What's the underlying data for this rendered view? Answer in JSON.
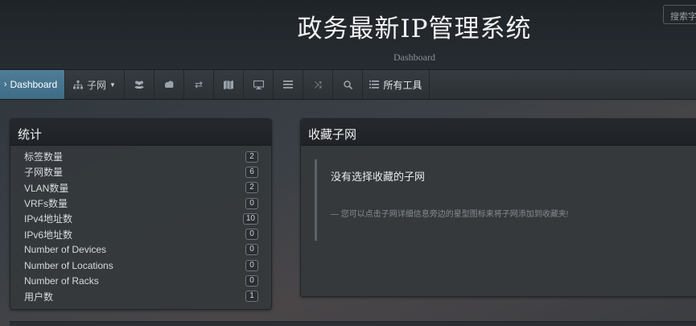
{
  "header": {
    "title": "政务最新IP管理系统",
    "subtitle": "Dashboard",
    "search_placeholder": "搜索字"
  },
  "nav": {
    "dashboard_label": "Dashboard",
    "subnets_label": "子网",
    "tools_label": "所有工具"
  },
  "stats": {
    "title": "统计",
    "rows": [
      {
        "label": "标签数量",
        "value": "2"
      },
      {
        "label": "子网数量",
        "value": "6"
      },
      {
        "label": "VLAN数量",
        "value": "2"
      },
      {
        "label": "VRFs数量",
        "value": "0"
      },
      {
        "label": "IPv4地址数",
        "value": "10"
      },
      {
        "label": "IPv6地址数",
        "value": "0"
      },
      {
        "label": "Number of Devices",
        "value": "0"
      },
      {
        "label": "Number of Locations",
        "value": "0"
      },
      {
        "label": "Number of Racks",
        "value": "0"
      },
      {
        "label": "用户数",
        "value": "1"
      }
    ]
  },
  "favourites": {
    "title": "收藏子网",
    "empty_title": "没有选择收藏的子网",
    "hint": "— 您可以点击子网详细信息旁边的星型图标来将子网添加到收藏夹!"
  }
}
